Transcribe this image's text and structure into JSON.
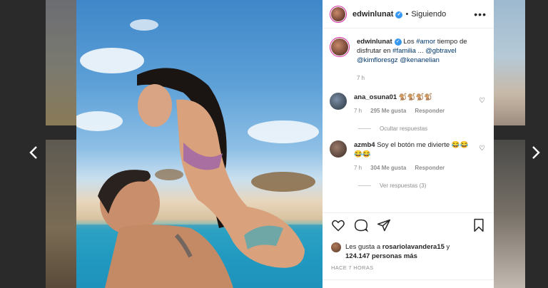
{
  "post": {
    "username": "edwinlunat",
    "follow_status": "Siguiendo",
    "more_label": "•••"
  },
  "caption": {
    "username": "edwinlunat",
    "text_prefix": " Los ",
    "hashtag_amor": "#amor",
    "text_middle": " tiempo de disfrutar en ",
    "hashtag_familia": "#familia",
    "text_ellipsis": " ... ",
    "mention1": "@gbtravel",
    "mention2": "@kimfloresgz",
    "mention3": "@kenanelian",
    "time": "7 h"
  },
  "comments": [
    {
      "username": "ana_osuna01",
      "text": " 🐒🐒🐒🐒",
      "time": "7 h",
      "likes": "295 Me gusta",
      "reply": "Responder",
      "replies_label": "Ocultar respuestas"
    },
    {
      "username": "azmb4",
      "text": " Soy el botón me divierte 😂😂😂😂",
      "time": "7 h",
      "likes": "304 Me gusta",
      "reply": "Responder",
      "replies_label": "Ver respuestas (3)"
    }
  ],
  "likes": {
    "prefix": "Les gusta a ",
    "user": "rosariolavandera15",
    "middle": " y ",
    "count": "124.147 personas más"
  },
  "posted_ago": "HACE 7 HORAS",
  "colors": {
    "verified": "#3897f0",
    "link": "#00376b",
    "secondary_text": "#8e8e8e"
  },
  "icons": [
    "chevron-left-icon",
    "chevron-right-icon",
    "heart-icon",
    "comment-icon",
    "share-icon",
    "bookmark-icon",
    "verified-icon",
    "more-icon"
  ]
}
